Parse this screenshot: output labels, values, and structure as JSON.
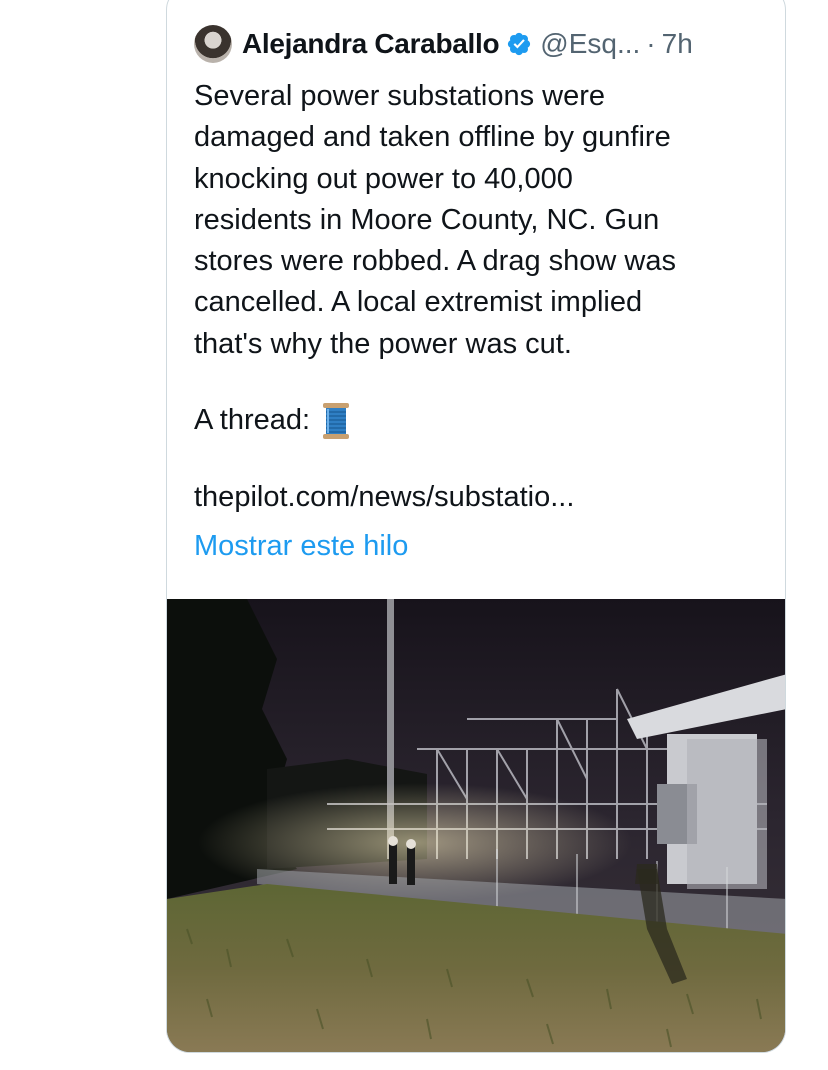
{
  "tweet": {
    "author_name": "Alejandra Caraballo",
    "handle": "@Esq...",
    "separator": "·",
    "time": "7h",
    "verified": true,
    "text_lines": [
      "Several power substations were",
      "damaged and taken offline by gunfire",
      "knocking out power to 40,000",
      "residents in Moore County, NC. Gun",
      "stores were robbed. A drag show was",
      "cancelled. A local extremist implied",
      "that's why the power was cut."
    ],
    "thread_label": "A thread:",
    "thread_emoji": "spool-of-thread",
    "link_text": "thepilot.com/news/substatio...",
    "show_thread_label": "Mostrar este hilo",
    "media": "photo-substation-at-night"
  },
  "colors": {
    "text": "#0f1419",
    "secondary": "#536471",
    "accent": "#1d9bf0",
    "border": "#cfd9de"
  }
}
